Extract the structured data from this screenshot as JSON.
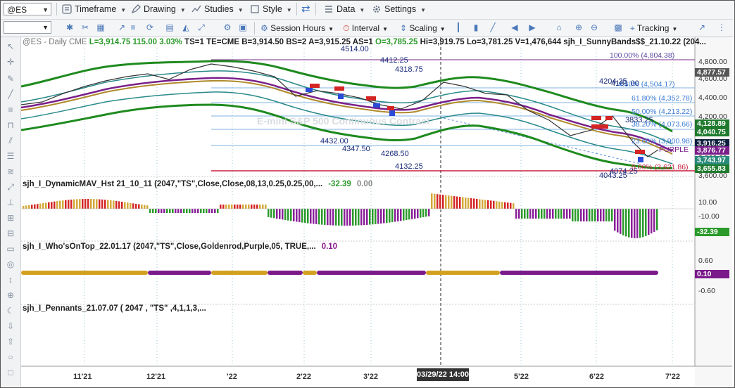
{
  "toolbar": {
    "symbol": "@ES",
    "menus": {
      "timeframe": "Timeframe",
      "drawing": "Drawing",
      "studies": "Studies",
      "style": "Style",
      "data": "Data",
      "settings": "Settings"
    },
    "row2": {
      "session_hours": "Session Hours",
      "interval": "Interval",
      "scaling": "Scaling",
      "tracking": "Tracking"
    }
  },
  "chart_header": {
    "symbol": "@ES - Daily",
    "exchange": "CME",
    "last": "L=3,914.75",
    "change": "115.00",
    "change_pct": "3.03%",
    "ts": "TS=1",
    "te": "TE=CME",
    "bid": "B=3,914.50",
    "bs": "BS=2",
    "ask": "A=3,915.25",
    "as": "AS=1",
    "open": "O=3,785.25",
    "high": "Hi=3,919.75",
    "low": "Lo=3,781.25",
    "volume": "V=1,476,644",
    "study": "sjh_I_SunnyBands$$_21.10.22 (204..."
  },
  "watermark": "E-mini S&P 500 Continuous Contract",
  "price_labels": [
    {
      "text": "4514.00"
    },
    {
      "text": "4412.25"
    },
    {
      "text": "4318.75"
    },
    {
      "text": "4204.25"
    },
    {
      "text": "4181.00"
    },
    {
      "text": "3833.25"
    },
    {
      "text": "4432.00"
    },
    {
      "text": "4347.50"
    },
    {
      "text": "4268.50"
    },
    {
      "text": "4132.25"
    },
    {
      "text": "4074.25"
    },
    {
      "text": "4043.25"
    }
  ],
  "fib_labels": [
    {
      "text": "100.00% (4,804.38)"
    },
    {
      "text": "4.60% (4,504.17)"
    },
    {
      "text": "61.80% (4,352.78)"
    },
    {
      "text": "50.00% (4,213.22)"
    },
    {
      "text": "38.20% (4,073.66)"
    },
    {
      "text": "23.60% (3,900.98)"
    },
    {
      "text": "0.00% (3,621.86)"
    }
  ],
  "purple_label": "PURPLE",
  "price_axis": {
    "ticks": [
      "4,800.00",
      "4,600.00",
      "4,400.00",
      "4,200.00",
      "3,800.00",
      "3,600.00"
    ],
    "tags": [
      {
        "text": "4,877.57",
        "color": "#555555"
      },
      {
        "text": "4,128.89",
        "color": "#1f7a2e"
      },
      {
        "text": "4,040.75",
        "color": "#1f7a2e"
      },
      {
        "text": "3,916.25",
        "color": "#0d1f3c"
      },
      {
        "text": "3,876.77",
        "color": "#7a1f8a"
      },
      {
        "text": "3,743.97",
        "color": "#2a8a7a"
      },
      {
        "text": "3,655.83",
        "color": "#1f7a2e"
      }
    ]
  },
  "indicator1": {
    "label": "sjh_I_DynamicMAV_Hst 21_10_11 (2047,\"TS\",Close,Close,08,13,0.25,0.25,00,...",
    "value1": "-32.39",
    "value2": "0.00",
    "axis": [
      "10.00",
      "-10.00"
    ],
    "tag": "-32.39"
  },
  "indicator2": {
    "label": "sjh_I_Who'sOnTop_22.01.17 (2047,\"TS\",Close,Goldenrod,Purple,05, TRUE,...",
    "value": "0.10",
    "axis": [
      "0.60",
      "-0.60"
    ],
    "tag": "0.10"
  },
  "indicator3": {
    "label": "sjh_I_Pennants_21.07.07 ( 2047 , \"TS\" ,4,1,1,3,..."
  },
  "time_axis": {
    "labels": [
      "11'21",
      "12'21",
      "'22",
      "2'22",
      "3'22",
      "5'22",
      "6'22",
      "7'22"
    ],
    "highlight": "03/29/22 14:00"
  },
  "colors": {
    "bands_outer": "#1e8a1e",
    "bands_mid": "#2a8a8a",
    "ma_purple": "#7a1f8a",
    "ma_gold": "#b08a2a",
    "hist_gold": "#d4a838",
    "hist_red": "#d42424",
    "hist_purple": "#8a1f9a",
    "hist_green": "#2a9a2a",
    "dot_gold": "#d4a020",
    "dot_purple": "#7a1a8a",
    "line_red": "#c81e3c",
    "line_purple": "#6a2a8a"
  }
}
